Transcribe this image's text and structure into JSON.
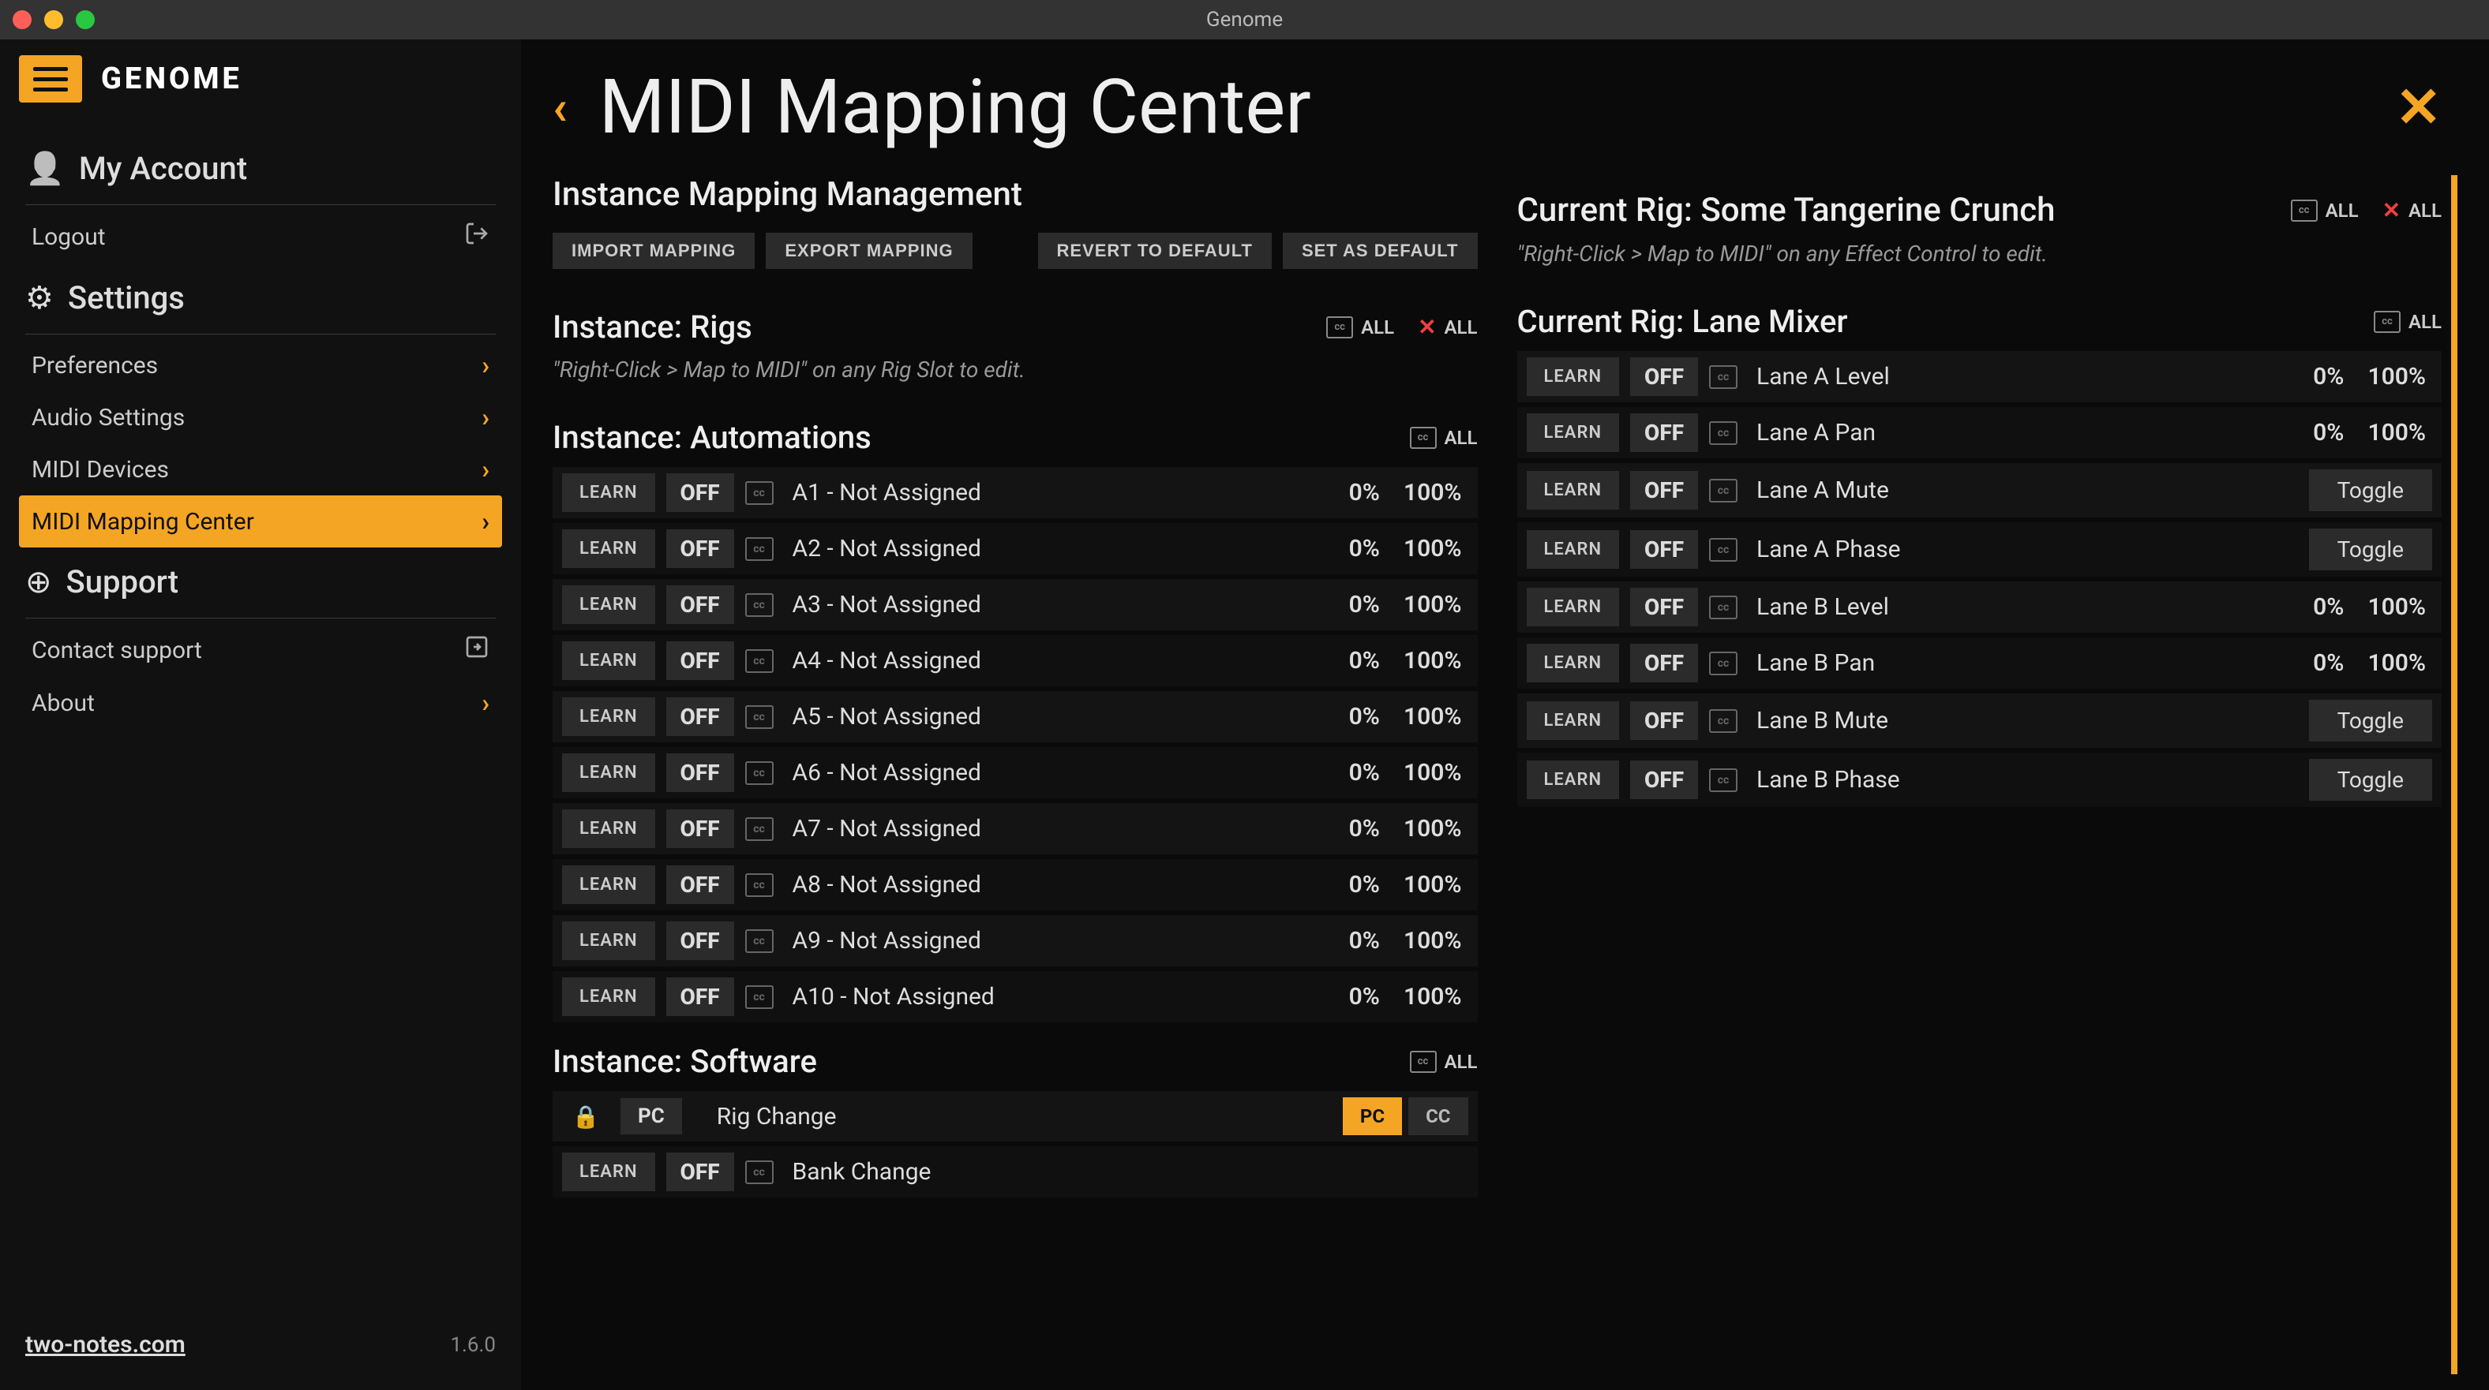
{
  "window": {
    "title": "Genome"
  },
  "brand": "GENOME",
  "sidebar": {
    "account_header": "My Account",
    "logout": "Logout",
    "settings_header": "Settings",
    "items": [
      {
        "label": "Preferences"
      },
      {
        "label": "Audio Settings"
      },
      {
        "label": "MIDI Devices"
      },
      {
        "label": "MIDI Mapping Center",
        "active": true
      }
    ],
    "support_header": "Support",
    "contact": "Contact support",
    "about": "About",
    "url": "two-notes.com",
    "version": "1.6.0"
  },
  "page": {
    "title": "MIDI Mapping Center"
  },
  "left": {
    "heading": "Instance Mapping Management",
    "buttons": {
      "import": "IMPORT MAPPING",
      "export": "EXPORT MAPPING",
      "revert": "REVERT TO DEFAULT",
      "default": "SET AS DEFAULT"
    },
    "rigs": {
      "title": "Instance: Rigs",
      "all": "ALL",
      "hint": "\"Right-Click > Map to MIDI\" on any Rig Slot to edit."
    },
    "automations": {
      "title": "Instance: Automations",
      "all": "ALL",
      "rows": [
        {
          "label": "A1 - Not Assigned",
          "min": "0%",
          "max": "100%"
        },
        {
          "label": "A2 - Not Assigned",
          "min": "0%",
          "max": "100%"
        },
        {
          "label": "A3 - Not Assigned",
          "min": "0%",
          "max": "100%"
        },
        {
          "label": "A4 - Not Assigned",
          "min": "0%",
          "max": "100%"
        },
        {
          "label": "A5 - Not Assigned",
          "min": "0%",
          "max": "100%"
        },
        {
          "label": "A6 - Not Assigned",
          "min": "0%",
          "max": "100%"
        },
        {
          "label": "A7 - Not Assigned",
          "min": "0%",
          "max": "100%"
        },
        {
          "label": "A8 - Not Assigned",
          "min": "0%",
          "max": "100%"
        },
        {
          "label": "A9 - Not Assigned",
          "min": "0%",
          "max": "100%"
        },
        {
          "label": "A10 - Not Assigned",
          "min": "0%",
          "max": "100%"
        }
      ]
    },
    "software": {
      "title": "Instance: Software",
      "all": "ALL",
      "rows": [
        {
          "label": "Rig Change",
          "locked": true,
          "pc": "PC",
          "tags": [
            "PC",
            "CC"
          ]
        },
        {
          "label": "Bank Change",
          "learn": true
        }
      ]
    },
    "learn": "LEARN",
    "off": "OFF"
  },
  "right": {
    "rig_title": "Current Rig: Some Tangerine Crunch",
    "all": "ALL",
    "hint": "\"Right-Click > Map to MIDI\" on any Effect Control to edit.",
    "mixer_title": "Current Rig: Lane Mixer",
    "rows": [
      {
        "label": "Lane A Level",
        "min": "0%",
        "max": "100%"
      },
      {
        "label": "Lane A Pan",
        "min": "0%",
        "max": "100%"
      },
      {
        "label": "Lane A Mute",
        "toggle": "Toggle"
      },
      {
        "label": "Lane A Phase",
        "toggle": "Toggle"
      },
      {
        "label": "Lane B Level",
        "min": "0%",
        "max": "100%"
      },
      {
        "label": "Lane B Pan",
        "min": "0%",
        "max": "100%"
      },
      {
        "label": "Lane B Mute",
        "toggle": "Toggle"
      },
      {
        "label": "Lane B Phase",
        "toggle": "Toggle"
      }
    ],
    "learn": "LEARN",
    "off": "OFF"
  }
}
